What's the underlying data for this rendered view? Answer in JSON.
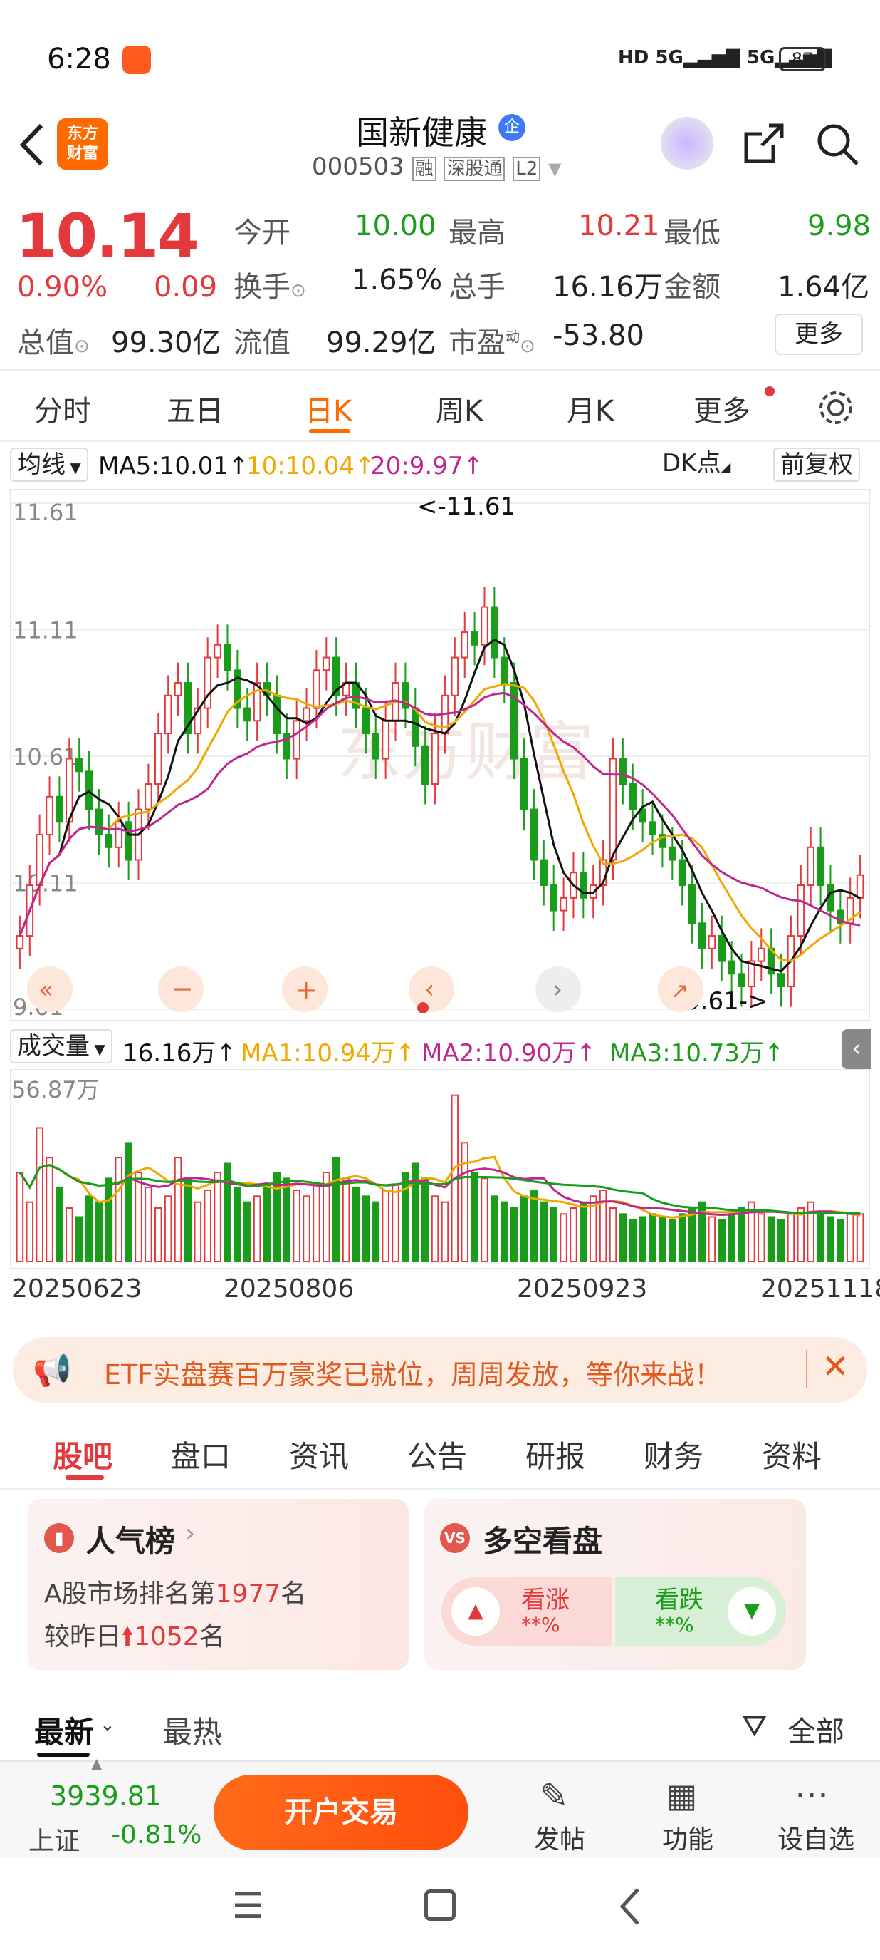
{
  "status": {
    "time": "6:28",
    "battery": "87"
  },
  "header": {
    "title": "国新健康",
    "code": "000503",
    "badge_rong": "融",
    "badge_sgt": "深股通",
    "badge_l2": "L2",
    "logo_line1": "东方",
    "logo_line2": "财富"
  },
  "quote": {
    "price": "10.14",
    "change_pct": "0.90%",
    "change_amt": "0.09",
    "open_label": "今开",
    "open": "10.00",
    "high_label": "最高",
    "high": "10.21",
    "low_label": "最低",
    "low": "9.98",
    "turnover_label": "换手",
    "turnover": "1.65%",
    "volume_label": "总手",
    "volume": "16.16万",
    "amount_label": "金额",
    "amount": "1.64亿",
    "mcap_label": "总值",
    "mcap": "99.30亿",
    "float_label": "流值",
    "float": "99.29亿",
    "pe_label": "市盈",
    "pe_super": "动",
    "pe": "-53.80",
    "more": "更多"
  },
  "tabs": [
    "分时",
    "五日",
    "日K",
    "周K",
    "月K",
    "更多"
  ],
  "chart_bar": {
    "ma_label": "均线",
    "ma5": "MA5:10.01↑",
    "ma10": "10:10.04↑",
    "ma20": "20:9.97↑",
    "dk": "DK点",
    "fq": "前复权"
  },
  "kchart": {
    "y_labels": [
      "11.61",
      "11.11",
      "10.61",
      "10.11",
      "9.61"
    ],
    "high_note": "<-11.61",
    "low_note": "9.61->",
    "watermark": "东方财富"
  },
  "vol": {
    "label": "成交量",
    "value": "16.16万↑",
    "ma1": "MA1:10.94万↑",
    "ma2": "MA2:10.90万↑",
    "ma3": "MA3:10.73万↑",
    "max_label": "56.87万"
  },
  "dates": [
    "20250623",
    "20250806",
    "20250923",
    "20251118"
  ],
  "banner": {
    "text": "ETF实盘赛百万豪奖已就位，周周发放，等你来战！"
  },
  "subtabs": [
    "股吧",
    "盘口",
    "资讯",
    "公告",
    "研报",
    "财务",
    "资料"
  ],
  "card_rank": {
    "title": "人气榜",
    "line1_a": "A股市场排名第",
    "line1_num": "1977",
    "line1_b": "名",
    "line2_a": "较昨日",
    "line2_num": "1052",
    "line2_b": "名"
  },
  "card_vs": {
    "title": "多空看盘",
    "up": "看涨",
    "up_val": "**%",
    "down": "看跌",
    "down_val": "**%"
  },
  "filter": {
    "latest": "最新",
    "hot": "最热",
    "all": "全部"
  },
  "bottom": {
    "index_val": "3939.81",
    "index_name": "上证",
    "index_chg": "-0.81%",
    "trade": "开户交易",
    "post": "发帖",
    "func": "功能",
    "fav": "设自选"
  },
  "colors": {
    "up": "#e4393c",
    "down": "#1a9d1a",
    "accent": "#ff6a00",
    "ma5": "#111111",
    "ma10": "#f0a800",
    "ma20": "#c0268f"
  },
  "chart_data": {
    "type": "candlestick",
    "x_labels": [
      "20250623",
      "20250806",
      "20250923",
      "20251118"
    ],
    "ylim": [
      9.61,
      11.61
    ],
    "y_ticks": [
      "11.61",
      "11.11",
      "10.61",
      "10.11",
      "9.61"
    ],
    "high": 11.61,
    "low": 9.61,
    "close": [
      9.9,
      10.1,
      10.3,
      10.45,
      10.35,
      10.6,
      10.55,
      10.4,
      10.3,
      10.25,
      10.35,
      10.2,
      10.4,
      10.5,
      10.7,
      10.85,
      10.9,
      10.7,
      10.8,
      11.0,
      11.05,
      10.95,
      10.8,
      10.75,
      10.9,
      10.85,
      10.7,
      10.6,
      10.75,
      10.8,
      10.95,
      11.0,
      10.85,
      10.9,
      10.8,
      10.7,
      10.6,
      10.75,
      10.9,
      10.8,
      10.65,
      10.5,
      10.7,
      10.85,
      11.0,
      11.1,
      11.05,
      11.2,
      11.0,
      10.9,
      10.6,
      10.4,
      10.2,
      10.1,
      10.0,
      10.05,
      10.15,
      10.05,
      10.1,
      10.2,
      10.6,
      10.5,
      10.4,
      10.35,
      10.3,
      10.25,
      10.2,
      10.1,
      9.95,
      9.85,
      9.9,
      9.8,
      9.75,
      9.7,
      9.8,
      9.85,
      9.75,
      9.7,
      9.9,
      10.1,
      10.25,
      10.1,
      10.0,
      9.95,
      10.05,
      10.14
    ],
    "volume": [
      30,
      20,
      45,
      35,
      25,
      18,
      15,
      22,
      20,
      28,
      35,
      40,
      30,
      25,
      18,
      22,
      35,
      28,
      20,
      24,
      30,
      33,
      25,
      20,
      22,
      26,
      30,
      28,
      24,
      22,
      26,
      30,
      35,
      28,
      25,
      22,
      20,
      24,
      26,
      30,
      33,
      28,
      22,
      20,
      56,
      40,
      30,
      28,
      22,
      20,
      18,
      22,
      24,
      20,
      18,
      16,
      18,
      20,
      22,
      24,
      18,
      16,
      14,
      15,
      16,
      15,
      14,
      16,
      18,
      20,
      15,
      14,
      16,
      18,
      20,
      16,
      15,
      14,
      16,
      18,
      20,
      16,
      15,
      14,
      16,
      16
    ]
  }
}
